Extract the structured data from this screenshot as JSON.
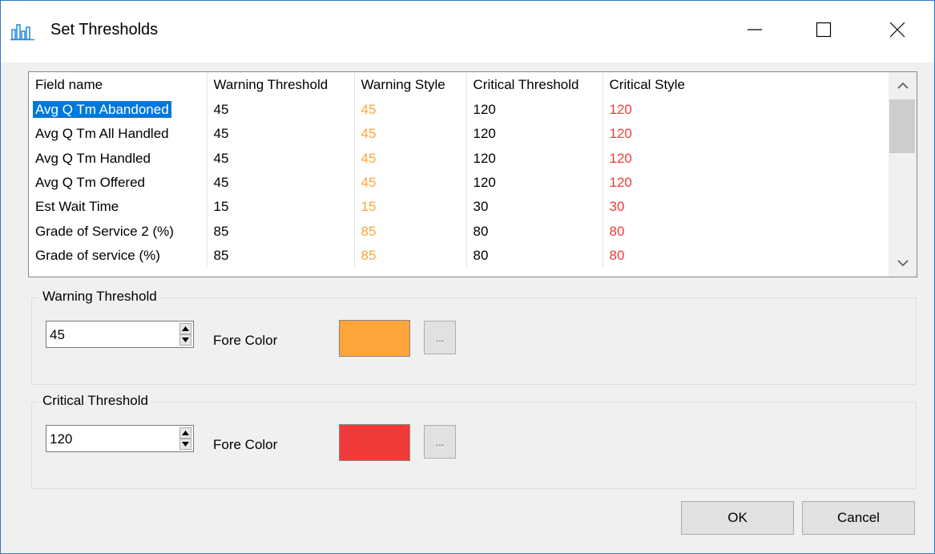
{
  "window": {
    "title": "Set Thresholds",
    "icon": "bar-chart-icon",
    "controls": [
      "minimize-icon",
      "maximize-icon",
      "close-icon"
    ]
  },
  "grid": {
    "columns": [
      "Field name",
      "Warning Threshold",
      "Warning Style",
      "Critical Threshold",
      "Critical Style"
    ],
    "rows": [
      {
        "field": "Avg Q Tm Abandoned",
        "warning": "45",
        "warning_style": "45",
        "critical": "120",
        "critical_style": "120"
      },
      {
        "field": "Avg Q Tm All Handled",
        "warning": "45",
        "warning_style": "45",
        "critical": "120",
        "critical_style": "120"
      },
      {
        "field": "Avg Q Tm Handled",
        "warning": "45",
        "warning_style": "45",
        "critical": "120",
        "critical_style": "120"
      },
      {
        "field": "Avg Q Tm Offered",
        "warning": "45",
        "warning_style": "45",
        "critical": "120",
        "critical_style": "120"
      },
      {
        "field": "Est Wait Time",
        "warning": "15",
        "warning_style": "15",
        "critical": "30",
        "critical_style": "30"
      },
      {
        "field": "Grade of Service 2 (%)",
        "warning": "85",
        "warning_style": "85",
        "critical": "80",
        "critical_style": "80"
      },
      {
        "field": "Grade of service (%)",
        "warning": "85",
        "warning_style": "85",
        "critical": "80",
        "critical_style": "80"
      }
    ],
    "selected_row": 0,
    "warning_style_color": "#ffa43a",
    "critical_style_color": "#f23a3a"
  },
  "warning_group": {
    "legend": "Warning Threshold",
    "value": "45",
    "fore_label": "Fore Color",
    "color": "#ffa43a",
    "picker_label": "..."
  },
  "critical_group": {
    "legend": "Critical Threshold",
    "value": "120",
    "fore_label": "Fore Color",
    "color": "#f23a3a",
    "picker_label": "..."
  },
  "buttons": {
    "ok": "OK",
    "cancel": "Cancel"
  }
}
